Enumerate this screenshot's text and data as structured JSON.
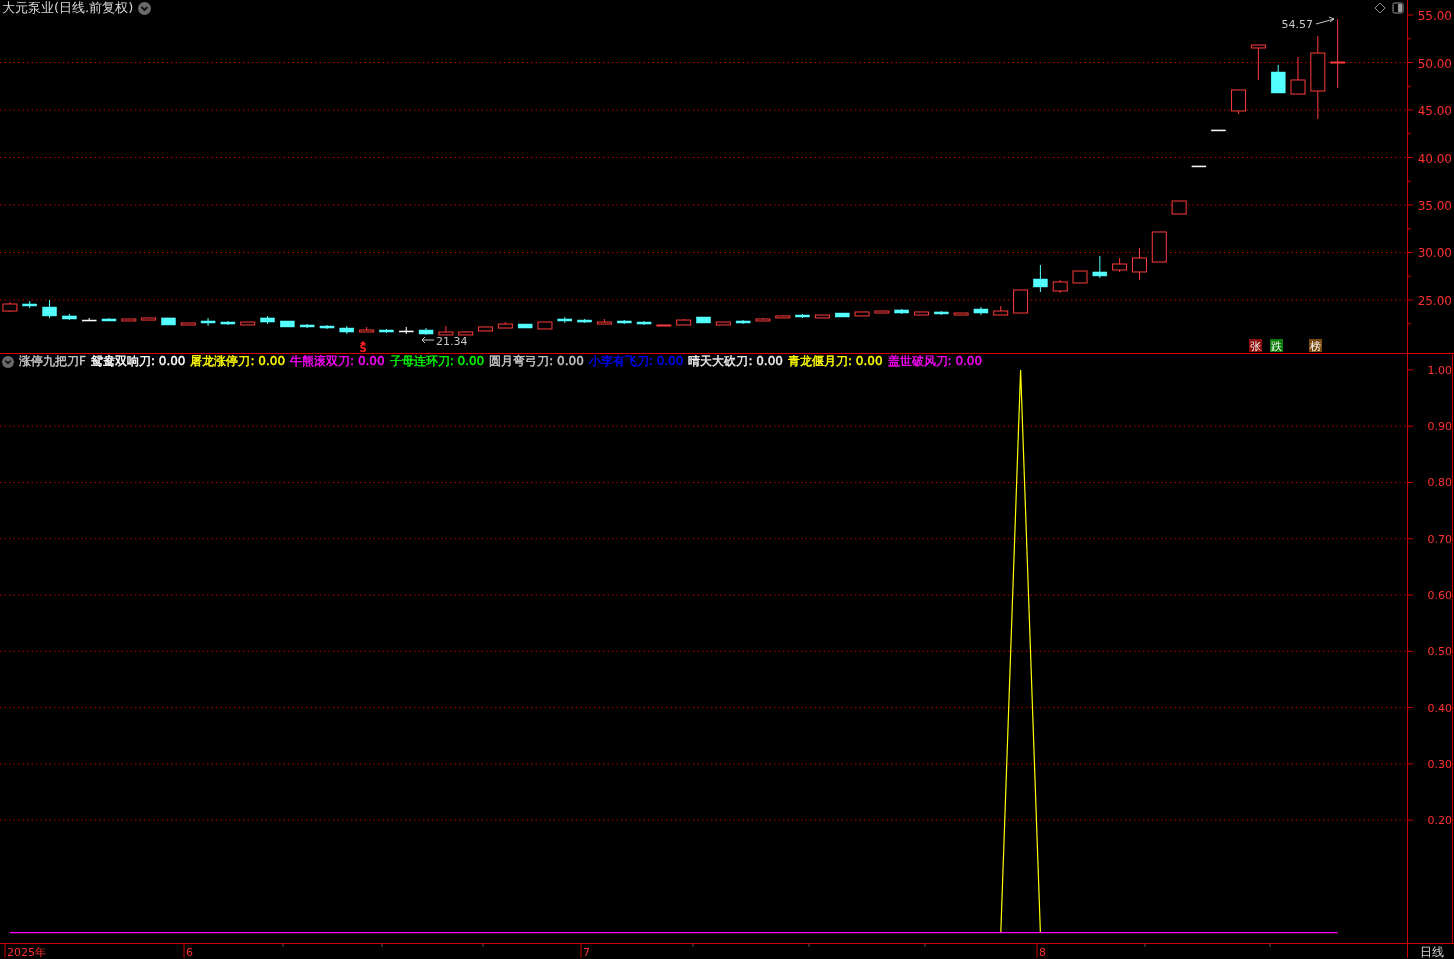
{
  "title": "大元泵业(日线.前复权)",
  "price_panel": {
    "high_label": "54.57",
    "low_label": "21.34",
    "signal_mark": "S",
    "badges": [
      {
        "text": "张",
        "color": "#8b0a0a"
      },
      {
        "text": "跌",
        "color": "#0a7a0a"
      },
      {
        "text": "榜",
        "color": "#7a4a10"
      }
    ],
    "chart_data": {
      "type": "candlestick",
      "grid": true,
      "ylim": [
        19.42,
        56.58
      ],
      "categories": [
        null,
        null,
        null,
        null,
        null,
        null,
        null,
        null,
        null,
        null,
        null,
        null,
        null,
        null,
        null,
        null,
        null,
        null,
        null,
        null,
        null,
        null,
        null,
        null,
        null,
        null,
        null,
        null,
        null,
        null,
        null,
        null,
        null,
        null,
        null,
        null,
        null,
        null,
        null,
        null,
        null,
        null,
        null,
        null,
        null,
        null,
        null,
        null,
        null,
        null,
        null,
        null,
        null,
        null,
        null,
        null,
        null,
        null,
        null,
        null,
        null,
        null,
        null,
        null,
        null,
        null,
        null,
        null,
        null,
        null,
        null
      ],
      "yticks": [
        {
          "value": 55,
          "label": "55.00"
        },
        {
          "value": 50,
          "label": "50.00"
        },
        {
          "value": 45,
          "label": "45.00"
        },
        {
          "value": 40,
          "label": "40.00"
        },
        {
          "value": 35,
          "label": "35.00"
        },
        {
          "value": 30,
          "label": "30.00"
        },
        {
          "value": 25,
          "label": "25.00"
        }
      ],
      "ohlc": [
        [
          23.84,
          24.79,
          23.74,
          24.58
        ],
        [
          24.58,
          24.89,
          24.16,
          24.37
        ],
        [
          24.26,
          25.0,
          23.11,
          23.32
        ],
        [
          23.32,
          23.53,
          22.89,
          23.0
        ],
        [
          22.89,
          23.11,
          22.79,
          22.89
        ],
        [
          23.0,
          23.11,
          22.79,
          22.79
        ],
        [
          22.79,
          23.0,
          22.79,
          23.0
        ],
        [
          22.89,
          23.11,
          22.89,
          23.11
        ],
        [
          23.11,
          23.11,
          22.37,
          22.37
        ],
        [
          22.37,
          22.58,
          22.37,
          22.58
        ],
        [
          22.79,
          23.11,
          22.26,
          22.58
        ],
        [
          22.68,
          22.79,
          22.37,
          22.47
        ],
        [
          22.37,
          22.68,
          22.37,
          22.68
        ],
        [
          23.11,
          23.32,
          22.47,
          22.68
        ],
        [
          22.79,
          22.79,
          22.16,
          22.16
        ],
        [
          22.37,
          22.47,
          22.05,
          22.16
        ],
        [
          22.26,
          22.37,
          21.95,
          22.05
        ],
        [
          22.05,
          22.26,
          21.42,
          21.63
        ],
        [
          21.63,
          22.16,
          21.63,
          21.84
        ],
        [
          21.84,
          21.95,
          21.53,
          21.63
        ],
        [
          21.74,
          22.16,
          21.42,
          21.74
        ],
        [
          21.84,
          22.05,
          21.34,
          21.42
        ],
        [
          21.32,
          22.26,
          21.32,
          21.63
        ],
        [
          21.32,
          21.74,
          21.32,
          21.63
        ],
        [
          21.74,
          22.16,
          21.74,
          22.16
        ],
        [
          22.05,
          22.68,
          22.05,
          22.47
        ],
        [
          22.47,
          22.47,
          22.05,
          22.05
        ],
        [
          21.95,
          22.68,
          21.95,
          22.68
        ],
        [
          23.0,
          23.21,
          22.58,
          22.79
        ],
        [
          22.89,
          23.0,
          22.58,
          22.68
        ],
        [
          22.47,
          23.0,
          22.47,
          22.68
        ],
        [
          22.79,
          22.89,
          22.47,
          22.58
        ],
        [
          22.68,
          22.79,
          22.37,
          22.47
        ],
        [
          22.26,
          22.37,
          22.26,
          22.37
        ],
        [
          22.37,
          23.0,
          22.37,
          22.89
        ],
        [
          23.21,
          23.21,
          22.58,
          22.58
        ],
        [
          22.37,
          22.68,
          22.37,
          22.68
        ],
        [
          22.79,
          22.89,
          22.47,
          22.58
        ],
        [
          22.79,
          23.11,
          22.79,
          23.0
        ],
        [
          23.11,
          23.42,
          23.11,
          23.32
        ],
        [
          23.42,
          23.53,
          23.11,
          23.21
        ],
        [
          23.11,
          23.42,
          23.11,
          23.42
        ],
        [
          23.63,
          23.63,
          23.21,
          23.21
        ],
        [
          23.32,
          23.74,
          23.32,
          23.74
        ],
        [
          23.63,
          23.84,
          23.63,
          23.84
        ],
        [
          23.95,
          24.05,
          23.53,
          23.63
        ],
        [
          23.42,
          23.74,
          23.42,
          23.74
        ],
        [
          23.74,
          23.84,
          23.42,
          23.53
        ],
        [
          23.42,
          23.63,
          23.42,
          23.63
        ],
        [
          24.05,
          24.26,
          23.42,
          23.63
        ],
        [
          23.42,
          24.37,
          23.42,
          23.84
        ],
        [
          23.63,
          26.05,
          23.63,
          26.05
        ],
        [
          27.21,
          28.68,
          25.84,
          26.37
        ],
        [
          25.95,
          27.11,
          25.74,
          26.9
        ],
        [
          26.79,
          28.05,
          26.79,
          28.05
        ],
        [
          27.95,
          29.63,
          27.32,
          27.53
        ],
        [
          28.16,
          29.42,
          27.95,
          28.79
        ],
        [
          27.95,
          30.47,
          27.11,
          29.42
        ],
        [
          29.0,
          32.16,
          29.0,
          32.16
        ],
        [
          34.05,
          35.42,
          34.05,
          35.42
        ],
        [
          39.11,
          39.11,
          39.11,
          39.11
        ],
        [
          42.9,
          42.9,
          42.9,
          42.9
        ],
        [
          44.9,
          47.11,
          44.58,
          47.11
        ],
        [
          51.53,
          51.84,
          48.16,
          51.84
        ],
        [
          49.0,
          49.74,
          46.79,
          46.79
        ],
        [
          46.68,
          50.58,
          46.68,
          48.16
        ],
        [
          47.0,
          52.79,
          44.05,
          51.0
        ],
        [
          50.0,
          54.57,
          47.32,
          50.05
        ],
        null,
        null,
        null
      ]
    }
  },
  "indicator": {
    "name": "涨停九把刀F",
    "legend": [
      {
        "label": "鸳鸯双响刀:",
        "value": "0.00",
        "color": "#ffffff"
      },
      {
        "label": "屠龙涨停刀:",
        "value": "0.00",
        "color": "#ffff00"
      },
      {
        "label": "牛熊滚双刀:",
        "value": "0.00",
        "color": "#ff00ff"
      },
      {
        "label": "子母连环刀:",
        "value": "0.00",
        "color": "#00ff00"
      },
      {
        "label": "圆月弯弓刀:",
        "value": "0.00",
        "color": "#c8c8c8"
      },
      {
        "label": "小李有飞刀:",
        "value": "0.00",
        "color": "#0000ff"
      },
      {
        "label": "晴天大砍刀:",
        "value": "0.00",
        "color": "#f0f0f0"
      },
      {
        "label": "青龙偃月刀:",
        "value": "0.00",
        "color": "#ffff01"
      },
      {
        "label": "盖世破风刀:",
        "value": "0.00",
        "color": "#ff00fe"
      }
    ],
    "chart_data": {
      "type": "line",
      "grid": true,
      "ylim": [
        -0.02,
        1.03
      ],
      "categories": [
        null,
        null,
        null,
        null,
        null,
        null,
        null,
        null,
        null,
        null,
        null,
        null,
        null,
        null,
        null,
        null,
        null,
        null,
        null,
        null,
        null,
        null,
        null,
        null,
        null,
        null,
        null,
        null,
        null,
        null,
        null,
        null,
        null,
        null,
        null,
        null,
        null,
        null,
        null,
        null,
        null,
        null,
        null,
        null,
        null,
        null,
        null,
        null,
        null,
        null,
        null,
        null,
        null,
        null,
        null,
        null,
        null,
        null,
        null,
        null,
        null,
        null,
        null,
        null,
        null,
        null,
        null,
        null,
        null,
        null,
        null
      ],
      "yticks": [
        {
          "value": 1,
          "label": "1.00"
        },
        {
          "value": 0.9,
          "label": "0.90"
        },
        {
          "value": 0.8,
          "label": "0.80"
        },
        {
          "value": 0.7,
          "label": "0.70"
        },
        {
          "value": 0.6,
          "label": "0.60"
        },
        {
          "value": 0.5,
          "label": "0.50"
        },
        {
          "value": 0.4,
          "label": "0.40"
        },
        {
          "value": 0.3,
          "label": "0.30"
        },
        {
          "value": 0.2,
          "label": "0.20"
        }
      ],
      "series": [
        {
          "color": "#ffff00",
          "values": [
            null,
            null,
            null,
            null,
            null,
            null,
            null,
            null,
            null,
            null,
            null,
            null,
            null,
            null,
            null,
            null,
            null,
            null,
            null,
            null,
            null,
            null,
            null,
            null,
            null,
            null,
            null,
            null,
            null,
            null,
            null,
            null,
            null,
            null,
            null,
            null,
            null,
            null,
            null,
            null,
            null,
            null,
            null,
            null,
            null,
            null,
            null,
            null,
            null,
            null,
            0,
            1,
            0,
            null,
            null,
            null,
            null,
            null,
            null,
            null,
            null,
            null,
            null,
            null,
            null,
            null,
            null,
            null,
            null,
            null,
            null
          ]
        },
        {
          "color": "#ff00ff",
          "values": [
            0,
            0,
            0,
            0,
            0,
            0,
            0,
            0,
            0,
            0,
            0,
            0,
            0,
            0,
            0,
            0,
            0,
            0,
            0,
            0,
            0,
            0,
            0,
            0,
            0,
            0,
            0,
            0,
            0,
            0,
            0,
            0,
            0,
            0,
            0,
            0,
            0,
            0,
            0,
            0,
            0,
            0,
            0,
            0,
            0,
            0,
            0,
            0,
            0,
            0,
            0,
            0,
            0,
            0,
            0,
            0,
            0,
            0,
            0,
            0,
            0,
            0,
            0,
            0,
            0,
            0,
            0,
            0,
            null,
            null,
            null
          ]
        }
      ]
    }
  },
  "time_axis": {
    "labels": [
      "2025年",
      "6",
      "7",
      "8"
    ]
  },
  "period": "日线"
}
